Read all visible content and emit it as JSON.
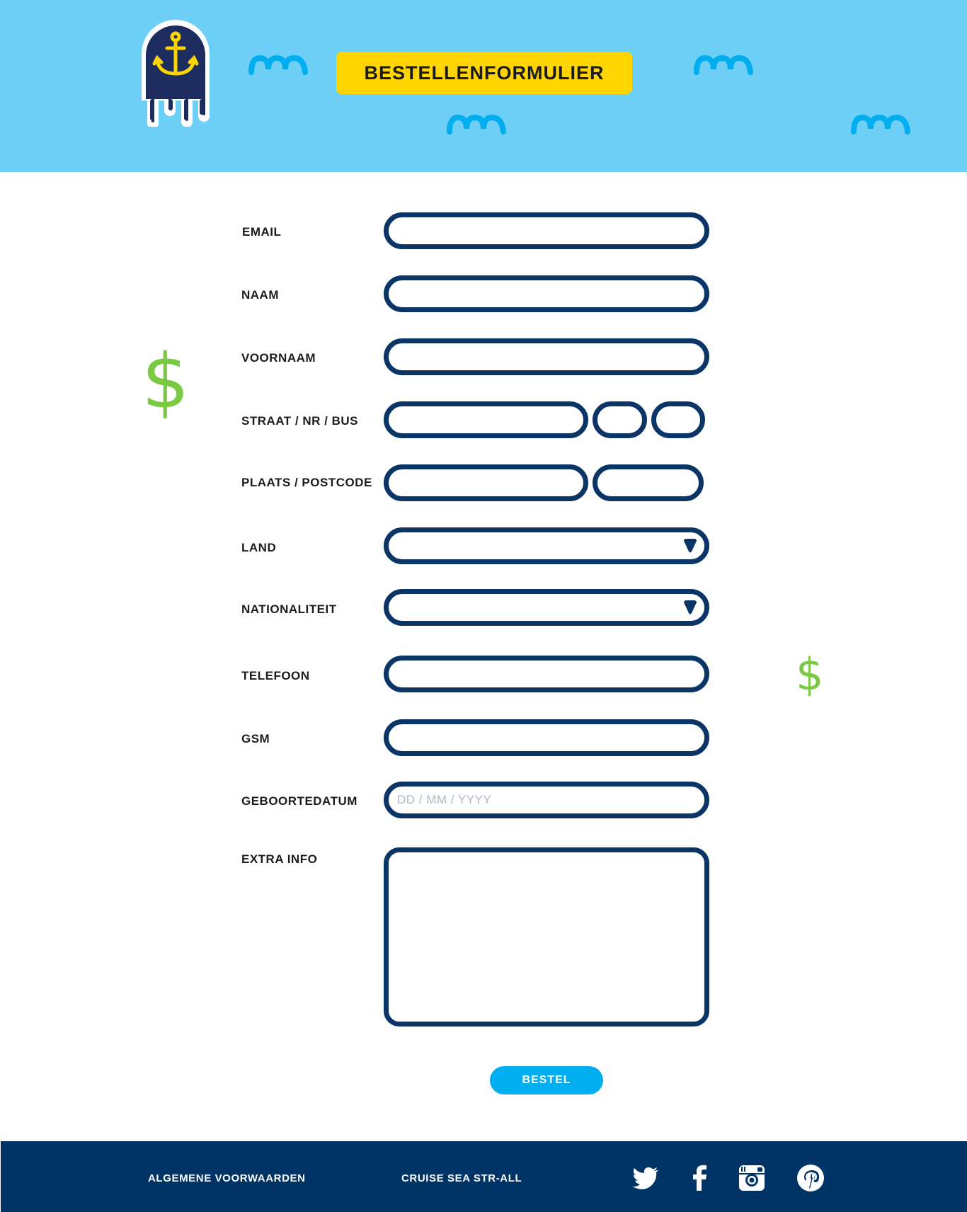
{
  "header": {
    "title": "BESTELLENFORMULIER",
    "logo_icon": "anchor-jellyfish-logo",
    "background": "#6dcff6",
    "accent": "#ffd500"
  },
  "form": {
    "email": {
      "label": "EMAIL",
      "value": ""
    },
    "naam": {
      "label": "NAAM",
      "value": ""
    },
    "voornaam": {
      "label": "VOORNAAM",
      "value": ""
    },
    "straat": {
      "label": "STRAAT / NR / BUS",
      "street": "",
      "nr": "",
      "bus": ""
    },
    "plaats": {
      "label": "PLAATS / POSTCODE",
      "city": "",
      "postcode": ""
    },
    "land": {
      "label": "LAND",
      "selected": ""
    },
    "nationaliteit": {
      "label": "NATIONALITEIT",
      "selected": ""
    },
    "telefoon": {
      "label": "TELEFOON",
      "value": ""
    },
    "gsm": {
      "label": "GSM",
      "value": ""
    },
    "geboortedatum": {
      "label": "GEBOORTEDATUM",
      "placeholder": "DD / MM / YYYY",
      "value": ""
    },
    "extra_info": {
      "label": "EXTRA INFO",
      "value": ""
    },
    "submit_label": "BESTEL",
    "border_color": "#0a3566",
    "button_color": "#00aeef"
  },
  "decor": {
    "dollar_symbol": "$",
    "dollar_color": "#7ac943"
  },
  "footer": {
    "links": [
      "ALGEMENE VOORWAARDEN",
      "CRUISE SEA STR-ALL"
    ],
    "social_icons": [
      "twitter-icon",
      "facebook-icon",
      "instagram-icon",
      "pinterest-icon"
    ],
    "background": "#003366"
  }
}
